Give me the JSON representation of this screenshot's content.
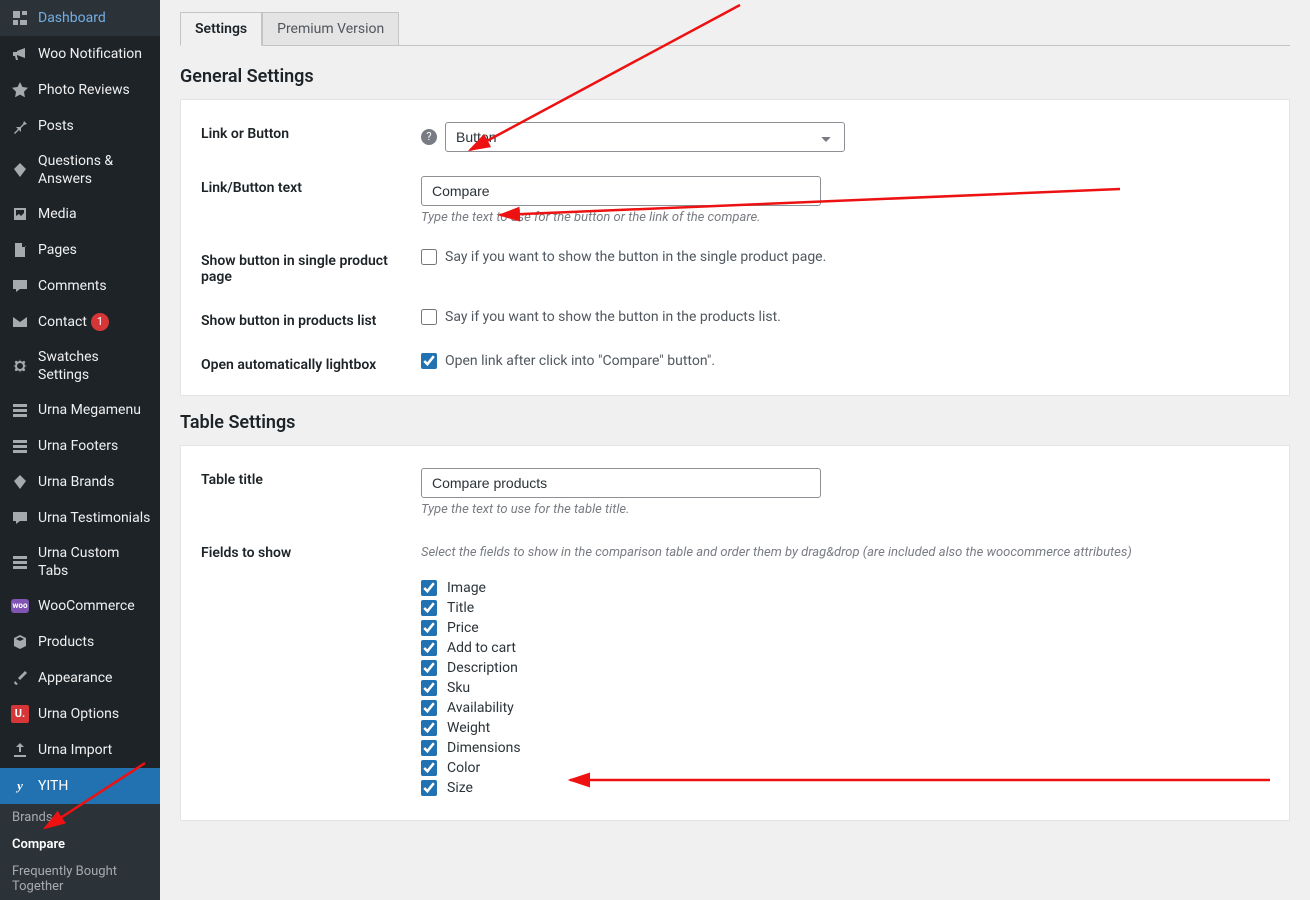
{
  "sidebar": {
    "items": [
      {
        "label": "Dashboard",
        "icon": "dashboard"
      },
      {
        "label": "Woo Notification",
        "icon": "megaphone"
      },
      {
        "label": "Photo Reviews",
        "icon": "star"
      },
      {
        "label": "Posts",
        "icon": "pin"
      },
      {
        "label": "Questions & Answers",
        "icon": "diamond"
      },
      {
        "label": "Media",
        "icon": "media"
      },
      {
        "label": "Pages",
        "icon": "page"
      },
      {
        "label": "Comments",
        "icon": "comment"
      },
      {
        "label": "Contact",
        "icon": "mail",
        "badge": "1"
      },
      {
        "label": "Swatches Settings",
        "icon": "gear"
      },
      {
        "label": "Urna Megamenu",
        "icon": "grid"
      },
      {
        "label": "Urna Footers",
        "icon": "grid"
      },
      {
        "label": "Urna Brands",
        "icon": "diamond"
      },
      {
        "label": "Urna Testimonials",
        "icon": "comment"
      },
      {
        "label": "Urna Custom Tabs",
        "icon": "grid"
      },
      {
        "label": "WooCommerce",
        "icon": "woo"
      },
      {
        "label": "Products",
        "icon": "cube"
      },
      {
        "label": "Appearance",
        "icon": "brush"
      },
      {
        "label": "Urna Options",
        "icon": "u"
      },
      {
        "label": "Urna Import",
        "icon": "upload"
      },
      {
        "label": "YITH",
        "icon": "y",
        "active": true
      }
    ],
    "sub": [
      {
        "label": "Brands"
      },
      {
        "label": "Compare",
        "active": true
      },
      {
        "label": "Frequently Bought Together"
      }
    ]
  },
  "tabs": [
    {
      "label": "Settings",
      "active": true
    },
    {
      "label": "Premium Version"
    }
  ],
  "sections": {
    "general": {
      "title": "General Settings",
      "fields": {
        "link_or_button": {
          "label": "Link or Button",
          "value": "Button"
        },
        "link_button_text": {
          "label": "Link/Button text",
          "value": "Compare",
          "desc": "Type the text to use for the button or the link of the compare."
        },
        "show_single": {
          "label": "Show button in single product page",
          "checked": false,
          "text": "Say if you want to show the button in the single product page."
        },
        "show_list": {
          "label": "Show button in products list",
          "checked": false,
          "text": "Say if you want to show the button in the products list."
        },
        "open_lightbox": {
          "label": "Open automatically lightbox",
          "checked": true,
          "text": "Open link after click into \"Compare\" button\"."
        }
      }
    },
    "table": {
      "title": "Table Settings",
      "fields": {
        "table_title": {
          "label": "Table title",
          "value": "Compare products",
          "desc": "Type the text to use for the table title."
        },
        "fields_to_show": {
          "label": "Fields to show",
          "desc": "Select the fields to show in the comparison table and order them by drag&drop (are included also the woocommerce attributes)"
        }
      },
      "field_list": [
        {
          "label": "Image",
          "checked": true
        },
        {
          "label": "Title",
          "checked": true
        },
        {
          "label": "Price",
          "checked": true
        },
        {
          "label": "Add to cart",
          "checked": true
        },
        {
          "label": "Description",
          "checked": true
        },
        {
          "label": "Sku",
          "checked": true
        },
        {
          "label": "Availability",
          "checked": true
        },
        {
          "label": "Weight",
          "checked": true
        },
        {
          "label": "Dimensions",
          "checked": true
        },
        {
          "label": "Color",
          "checked": true
        },
        {
          "label": "Size",
          "checked": true
        }
      ]
    }
  }
}
